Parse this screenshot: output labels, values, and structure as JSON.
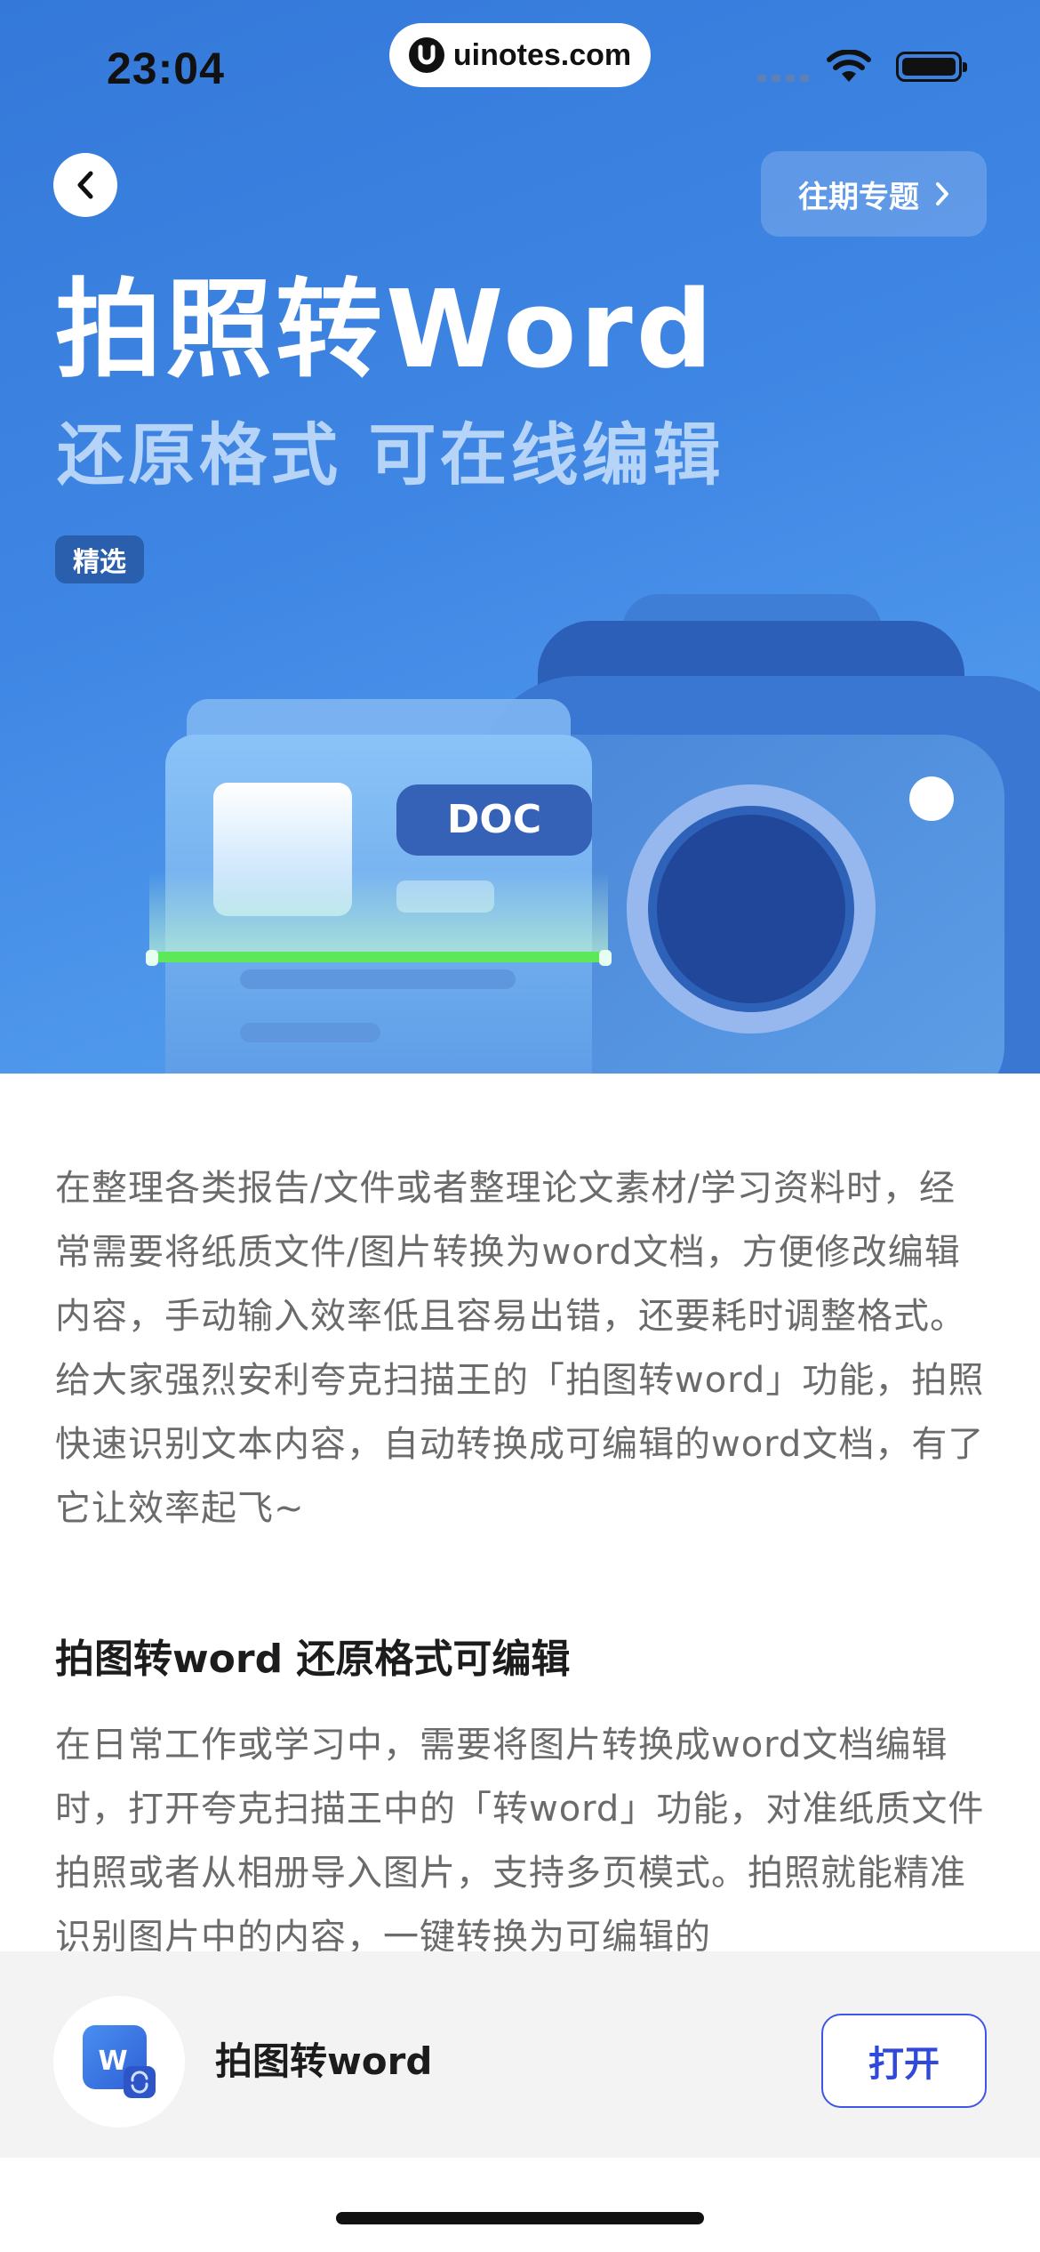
{
  "status_bar": {
    "time": "23:04",
    "url": "uinotes.com"
  },
  "header": {
    "back_icon": "chevron-left-icon",
    "past_topics_label": "往期专题",
    "past_topics_icon": "chevron-right-icon"
  },
  "hero": {
    "title": "拍照转Word",
    "subtitle": "还原格式 可在线编辑",
    "tag": "精选",
    "doc_label": "DOC",
    "colors": {
      "background": "#3f86e4",
      "scan_line": "#5de85a",
      "subtitle": "#b5d4f8"
    }
  },
  "article": {
    "intro": "在整理各类报告/文件或者整理论文素材/学习资料时，经常需要将纸质文件/图片转换为word文档，方便修改编辑内容，手动输入效率低且容易出错，还要耗时调整格式。给大家强烈安利夸克扫描王的「拍图转word」功能，拍照快速识别文本内容，自动转换成可编辑的word文档，有了它让效率起飞~",
    "section_heading": "拍图转word 还原格式可编辑",
    "section_body": "在日常工作或学习中，需要将图片转换成word文档编辑时，打开夸克扫描王中的「转word」功能，对准纸质文件拍照或者从相册导入图片，支持多页模式。拍照就能精准识别图片中的内容，一键转换为可编辑的"
  },
  "bottom_bar": {
    "app_icon": "word-convert-icon",
    "app_icon_letter": "W",
    "app_name": "拍图转word",
    "open_label": "打开",
    "accent_color": "#3d56e6"
  }
}
